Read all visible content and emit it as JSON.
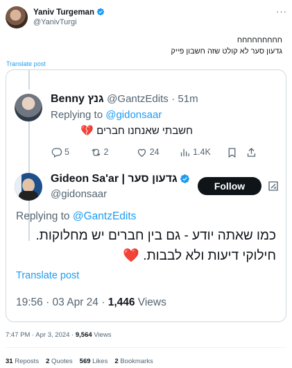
{
  "post": {
    "author_name": "Yaniv Turgeman",
    "author_handle": "@YanivTurgi",
    "text_line1": "חחחחחחחחח",
    "text_line2": "גדעון סער לא קולט שזה חשבון פייק",
    "translate_label": "Translate post",
    "more_label": "···"
  },
  "quote": {
    "reply": {
      "author_name": "Benny גנץ",
      "author_handle": "@GantzEdits",
      "time": "· 51m",
      "replying_prefix": "Replying to",
      "replying_to": "@gidonsaar",
      "text": "חשבתי שאנחנו חברים",
      "emoji": "💔",
      "actions": {
        "replies": "5",
        "reposts": "2",
        "likes": "24",
        "views": "1.4K"
      }
    },
    "main": {
      "author_name": "Gideon Sa'ar | גדעון סער",
      "author_handle": "@gidonsaar",
      "follow_label": "Follow",
      "replying_prefix": "Replying to",
      "replying_to": "@GantzEdits",
      "text_line1": "כמו שאתה יודע - גם בין חברים יש מחלוקות.",
      "text_line2": "חילוקי דיעות ולא לבבות.",
      "emoji": "❤️",
      "translate_label": "Translate post",
      "timestamp": "19:56 · 03 Apr 24 · ",
      "views_count": "1,446",
      "views_label": " Views"
    }
  },
  "footer": {
    "timestamp": "7:47 PM · Apr 3, 2024 · ",
    "views_count": "9,564",
    "views_label": " Views",
    "reposts_count": "31",
    "reposts_label": "Reposts",
    "quotes_count": "2",
    "quotes_label": "Quotes",
    "likes_count": "569",
    "likes_label": "Likes",
    "bookmarks_count": "2",
    "bookmarks_label": "Bookmarks"
  },
  "colors": {
    "accent": "#1d9bf0",
    "text": "#0f1419",
    "muted": "#536471",
    "border": "#cfd9de",
    "heart": "#e0245e"
  }
}
